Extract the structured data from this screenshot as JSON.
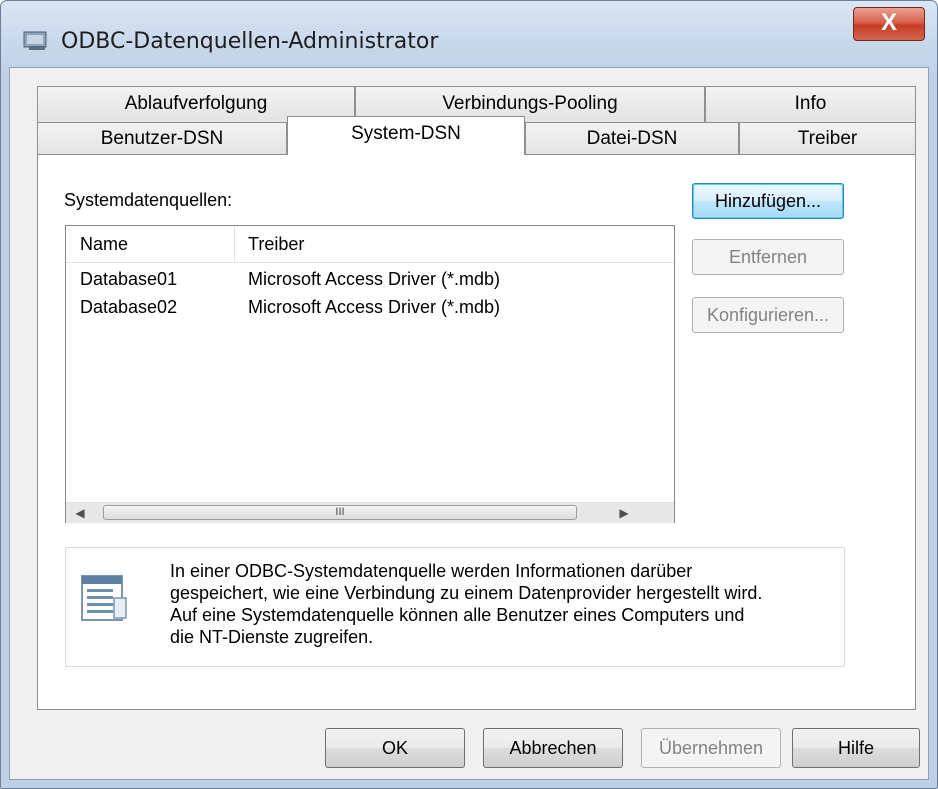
{
  "window": {
    "title": "ODBC-Datenquellen-Administrator",
    "close_label": "X"
  },
  "tabs": {
    "row1": [
      {
        "label": "Ablaufverfolgung"
      },
      {
        "label": "Verbindungs-Pooling"
      },
      {
        "label": "Info"
      }
    ],
    "row2": [
      {
        "label": "Benutzer-DSN"
      },
      {
        "label": "System-DSN",
        "active": true
      },
      {
        "label": "Datei-DSN"
      },
      {
        "label": "Treiber"
      }
    ]
  },
  "panel": {
    "list_label": "Systemdatenquellen:",
    "columns": [
      "Name",
      "Treiber"
    ],
    "rows": [
      {
        "name": "Database01",
        "driver": "Microsoft Access Driver (*.mdb)"
      },
      {
        "name": "Database02",
        "driver": "Microsoft Access Driver (*.mdb)"
      }
    ],
    "scroll_thumb_grip": "III",
    "buttons": {
      "add": "Hinzufügen...",
      "remove": "Entfernen",
      "configure": "Konfigurieren..."
    },
    "info_lines": [
      "In einer ODBC-Systemdatenquelle werden Informationen darüber",
      "gespeichert, wie eine Verbindung zu einem Datenprovider hergestellt wird.",
      "Auf eine Systemdatenquelle können alle Benutzer eines Computers und",
      "die NT-Dienste zugreifen."
    ]
  },
  "footer": {
    "ok": "OK",
    "cancel": "Abbrechen",
    "apply": "Übernehmen",
    "help": "Hilfe"
  },
  "icons": {
    "app": "database-admin-icon",
    "info": "data-source-icon"
  },
  "colors": {
    "default_button_border": "#3c7fb1",
    "close_button": "#c43e24"
  }
}
